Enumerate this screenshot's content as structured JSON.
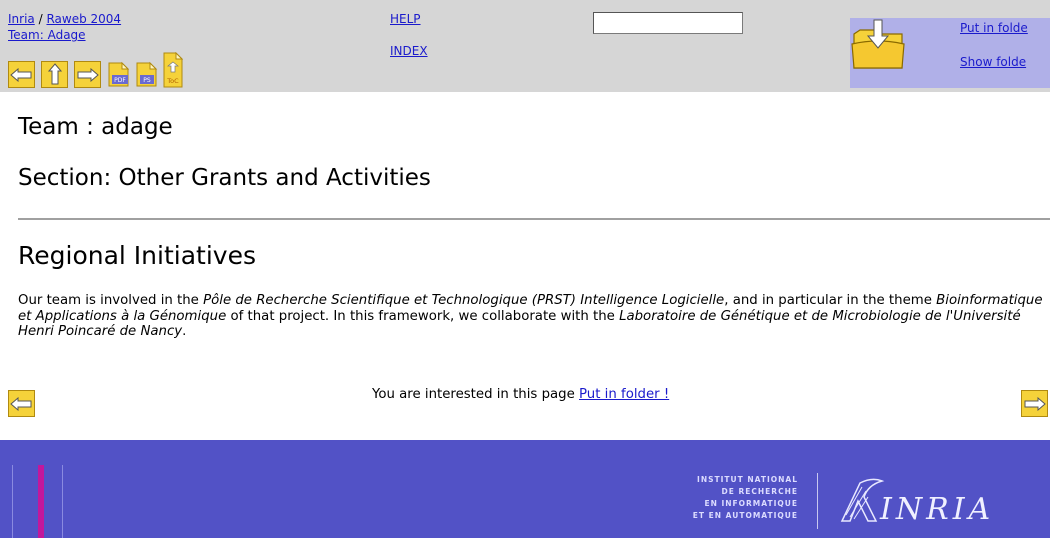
{
  "header": {
    "breadcrumb": {
      "root": "Inria",
      "separator": "/",
      "item": "Raweb 2004",
      "team_link": "Team: Adage"
    },
    "help_label": "HELP",
    "index_label": "INDEX",
    "search_value": "",
    "folder": {
      "put_label": "Put in folde",
      "show_label": "Show folde"
    },
    "nav_icons": [
      "prev-arrow-icon",
      "up-arrow-icon",
      "next-arrow-icon",
      "pdf-icon",
      "ps-icon",
      "toc-icon"
    ],
    "icon_labels": {
      "pdf": "PDF",
      "ps": "PS",
      "toc": "ToC"
    }
  },
  "content": {
    "team_title": "Team : adage",
    "section_title": "Section: Other Grants and Activities",
    "subsection_title": "Regional Initiatives",
    "paragraph": {
      "t1": "Our team is involved in the ",
      "i1": "Pôle de Recherche Scientifique et Technologique (PRST) Intelligence Logicielle",
      "t2": ", and in particular in the theme ",
      "i2": "Bioinformatique et Applications à la Génomique",
      "t3": " of that project. In this framework, we collaborate with the ",
      "i3": "Laboratoire de Génétique et de Microbiologie de l'Université Henri Poincaré de Nancy",
      "t4": "."
    },
    "interest_text": "You are interested in this page ",
    "interest_link": "Put in folder !"
  },
  "footer": {
    "institute_lines": [
      "INSTITUT NATIONAL",
      "DE RECHERCHE",
      "EN INFORMATIQUE",
      "ET EN AUTOMATIQUE"
    ],
    "logo_text": "INRIA"
  },
  "colors": {
    "top_bar": "#d6d6d6",
    "folder_panel": "#b0b0e8",
    "footer_bg": "#5252c6",
    "link": "#1a1acc",
    "button_yellow": "#f5d23a"
  }
}
